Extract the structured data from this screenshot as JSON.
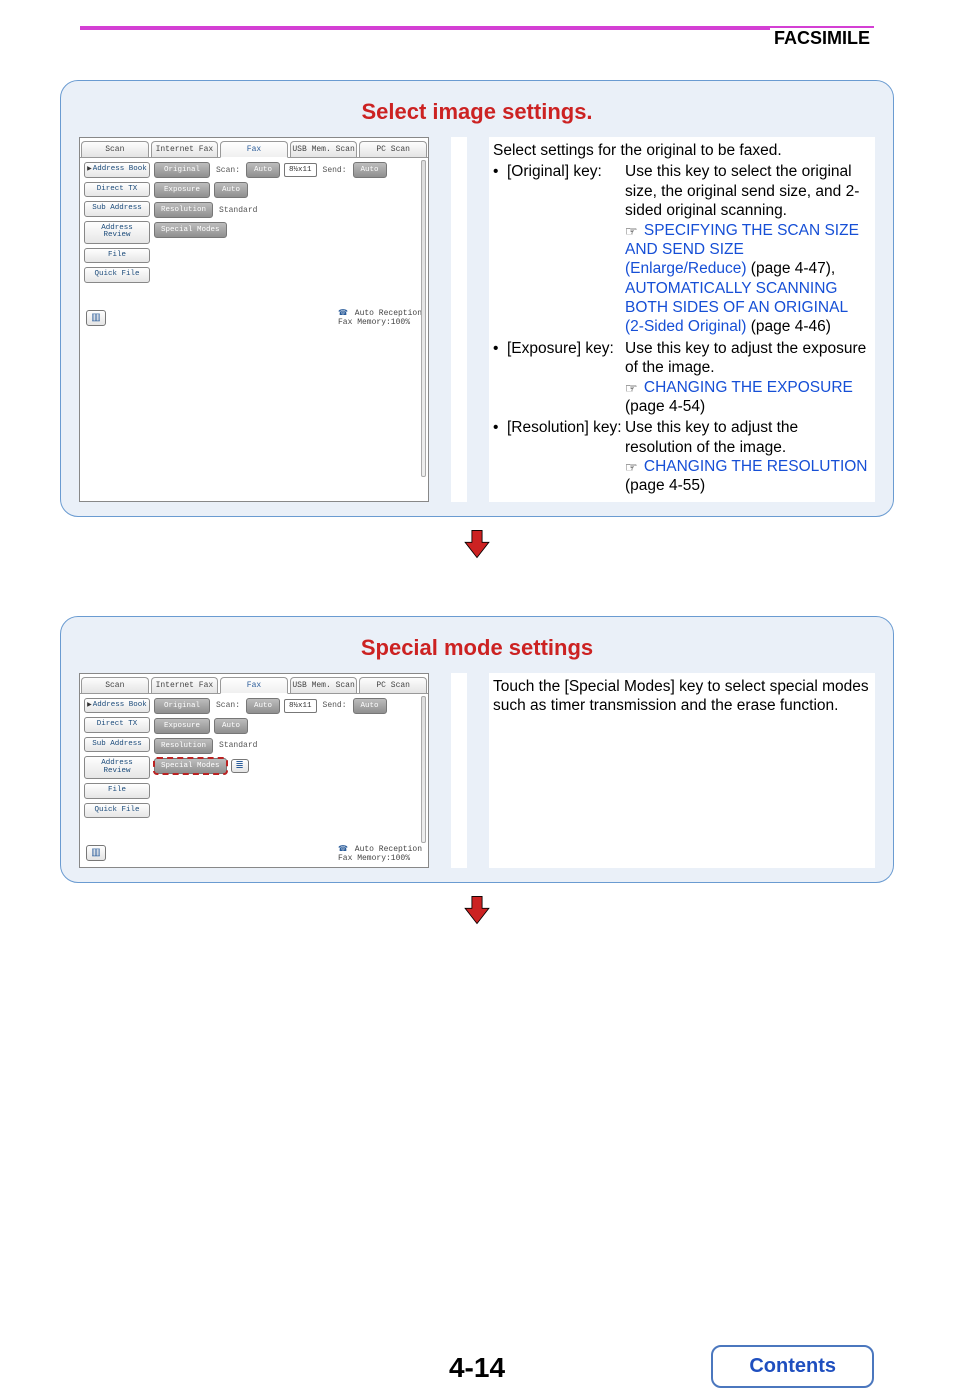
{
  "header": {
    "section": "FACSIMILE"
  },
  "pagenum": "4-14",
  "contents_button": "Contents",
  "card1": {
    "title": "Select image settings.",
    "intro": "Select settings for the original to be faxed.",
    "items": [
      {
        "key": "[Original] key:",
        "body": "Use this key to select the original size, the original send size, and 2-sided original scanning.",
        "links": [
          {
            "text": "SPECIFYING THE SCAN SIZE AND SEND SIZE (Enlarge/Reduce)",
            "tail": " (page 4-47), "
          },
          {
            "text": "AUTOMATICALLY SCANNING BOTH SIDES OF AN ORIGINAL (2-Sided Original)",
            "tail": " (page 4-46)"
          }
        ]
      },
      {
        "key": "[Exposure] key:",
        "body": "Use this key to adjust the exposure of the image.",
        "links": [
          {
            "text": "CHANGING THE EXPOSURE",
            "tail": " (page 4-54)"
          }
        ]
      },
      {
        "key": "[Resolution] key:",
        "body": "Use this key to adjust the resolution of the image.",
        "links": [
          {
            "text": "CHANGING THE RESOLUTION",
            "tail": " (page 4-55)"
          }
        ]
      }
    ]
  },
  "card2": {
    "title": "Special mode settings",
    "body": "Touch the [Special Modes] key to select special modes such as timer transmission and the erase function."
  },
  "ui": {
    "tabs": [
      "Scan",
      "Internet Fax",
      "Fax",
      "USB Mem. Scan",
      "PC Scan"
    ],
    "active_tab": 2,
    "side": [
      "Address Book",
      "Direct TX",
      "Sub Address",
      "Address Review",
      "File",
      "Quick File"
    ],
    "rows": {
      "original": {
        "btn": "Original",
        "scan_lbl": "Scan:",
        "auto": "Auto",
        "paper": "8½x11",
        "send_lbl": "Send:",
        "send": "Auto"
      },
      "exposure": {
        "btn": "Exposure",
        "val": "Auto"
      },
      "resolution": {
        "btn": "Resolution",
        "val": "Standard"
      },
      "special": {
        "btn": "Special Modes"
      }
    },
    "status": {
      "line1": "Auto Reception",
      "line2": "Fax Memory:100%"
    }
  }
}
